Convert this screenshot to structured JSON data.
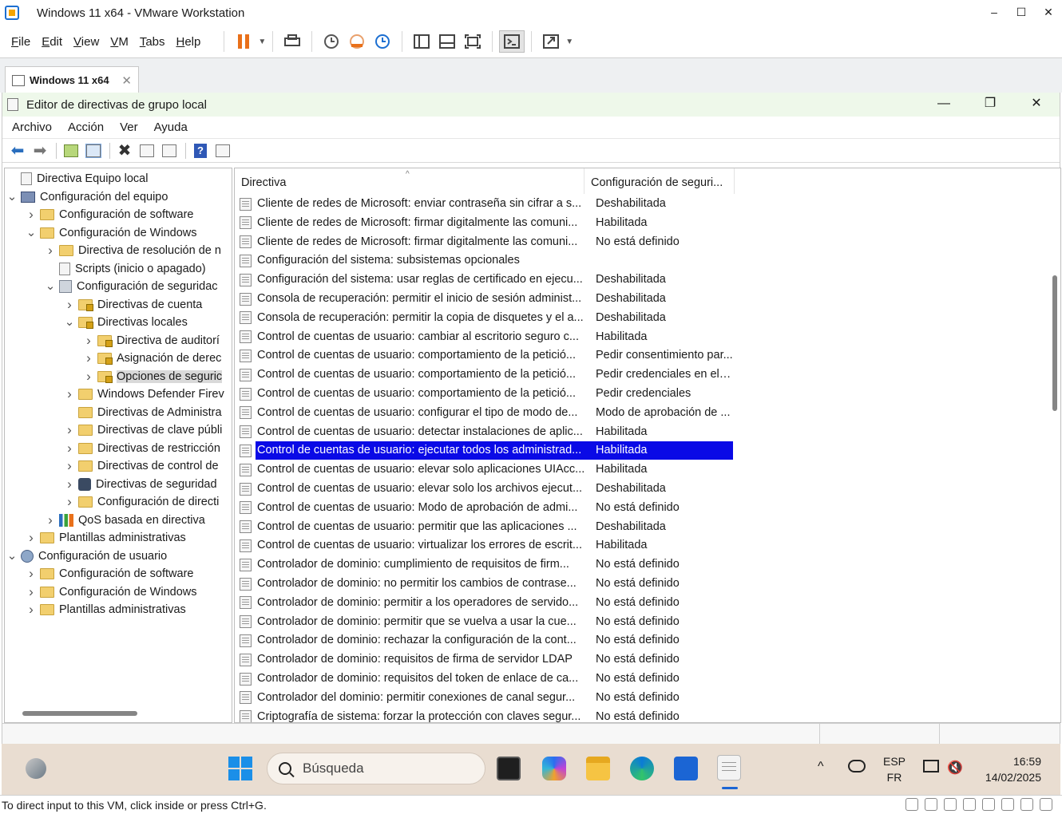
{
  "vm": {
    "title": "Windows 11 x64 - VMware Workstation",
    "menu": [
      {
        "label": "File",
        "u": "F",
        "rest": "ile"
      },
      {
        "label": "Edit",
        "u": "E",
        "rest": "dit"
      },
      {
        "label": "View",
        "u": "V",
        "rest": "iew"
      },
      {
        "label": "VM",
        "u": "V",
        "rest": "M"
      },
      {
        "label": "Tabs",
        "u": "T",
        "rest": "abs"
      },
      {
        "label": "Help",
        "u": "H",
        "rest": "elp"
      }
    ],
    "window_controls": {
      "minimize": "–",
      "maximize": "☐",
      "close": "✕"
    },
    "tab_label": "Windows 11 x64",
    "tab_close": "✕",
    "status_message": "To direct input to this VM, click inside or press Ctrl+G."
  },
  "gpe": {
    "title": "Editor de directivas de grupo local",
    "window_controls": {
      "minimize": "—",
      "restore": "❐",
      "close": "✕"
    },
    "menu": [
      "Archivo",
      "Acción",
      "Ver",
      "Ayuda"
    ],
    "tree": [
      {
        "label": "Directiva Equipo local",
        "level": 0,
        "chev": "",
        "icon": "doc"
      },
      {
        "label": "Configuración del equipo",
        "level": 0,
        "chev": "v",
        "icon": "computer"
      },
      {
        "label": "Configuración de software",
        "level": 1,
        "chev": ">",
        "icon": "folder"
      },
      {
        "label": "Configuración de Windows",
        "level": 1,
        "chev": "v",
        "icon": "folder"
      },
      {
        "label": "Directiva de resolución de n",
        "level": 2,
        "chev": ">",
        "icon": "folder"
      },
      {
        "label": "Scripts (inicio o apagado)",
        "level": 2,
        "chev": "",
        "icon": "doc"
      },
      {
        "label": "Configuración de seguridac",
        "level": 2,
        "chev": "v",
        "icon": "secure"
      },
      {
        "label": "Directivas de cuenta",
        "level": 3,
        "chev": ">",
        "icon": "folder-lock"
      },
      {
        "label": "Directivas locales",
        "level": 3,
        "chev": "v",
        "icon": "folder-lock"
      },
      {
        "label": "Directiva de auditorí",
        "level": 4,
        "chev": ">",
        "icon": "folder-lock"
      },
      {
        "label": "Asignación de derec",
        "level": 4,
        "chev": ">",
        "icon": "folder-lock"
      },
      {
        "label": "Opciones de seguric",
        "level": 4,
        "chev": ">",
        "icon": "folder-lock",
        "selected": true
      },
      {
        "label": "Windows Defender Firev",
        "level": 3,
        "chev": ">",
        "icon": "folder"
      },
      {
        "label": "Directivas de Administra",
        "level": 3,
        "chev": "",
        "icon": "folder"
      },
      {
        "label": "Directivas de clave públi",
        "level": 3,
        "chev": ">",
        "icon": "folder"
      },
      {
        "label": "Directivas de restricción",
        "level": 3,
        "chev": ">",
        "icon": "folder"
      },
      {
        "label": "Directivas de control de",
        "level": 3,
        "chev": ">",
        "icon": "folder"
      },
      {
        "label": "Directivas de seguridad",
        "level": 3,
        "chev": ">",
        "icon": "shield"
      },
      {
        "label": "Configuración de directi",
        "level": 3,
        "chev": ">",
        "icon": "folder"
      },
      {
        "label": "QoS basada en directiva",
        "level": 2,
        "chev": ">",
        "icon": "chart"
      },
      {
        "label": "Plantillas administrativas",
        "level": 1,
        "chev": ">",
        "icon": "folder"
      },
      {
        "label": "Configuración de usuario",
        "level": 0,
        "chev": "v",
        "icon": "user"
      },
      {
        "label": "Configuración de software",
        "level": 1,
        "chev": ">",
        "icon": "folder"
      },
      {
        "label": "Configuración de Windows",
        "level": 1,
        "chev": ">",
        "icon": "folder"
      },
      {
        "label": "Plantillas administrativas",
        "level": 1,
        "chev": ">",
        "icon": "folder"
      }
    ],
    "columns": [
      "Directiva",
      "Configuración de seguri..."
    ],
    "sort_indicator": "^",
    "policies": [
      {
        "name": "Cliente de redes de Microsoft: enviar contraseña sin cifrar a s...",
        "value": "Deshabilitada"
      },
      {
        "name": "Cliente de redes de Microsoft: firmar digitalmente las comuni...",
        "value": "Habilitada"
      },
      {
        "name": "Cliente de redes de Microsoft: firmar digitalmente las comuni...",
        "value": "No está definido"
      },
      {
        "name": "Configuración del sistema: subsistemas opcionales",
        "value": ""
      },
      {
        "name": "Configuración del sistema: usar reglas de certificado en ejecu...",
        "value": "Deshabilitada"
      },
      {
        "name": "Consola de recuperación: permitir el inicio de sesión administ...",
        "value": "Deshabilitada"
      },
      {
        "name": "Consola de recuperación: permitir la copia de disquetes y el a...",
        "value": "Deshabilitada"
      },
      {
        "name": "Control de cuentas de usuario: cambiar al escritorio seguro c...",
        "value": "Habilitada"
      },
      {
        "name": "Control de cuentas de usuario: comportamiento de la petició...",
        "value": "Pedir consentimiento par..."
      },
      {
        "name": "Control de cuentas de usuario: comportamiento de la petició...",
        "value": "Pedir credenciales en el e..."
      },
      {
        "name": "Control de cuentas de usuario: comportamiento de la petició...",
        "value": "Pedir credenciales"
      },
      {
        "name": "Control de cuentas de usuario: configurar el tipo de modo de...",
        "value": "Modo de aprobación de ..."
      },
      {
        "name": "Control de cuentas de usuario: detectar instalaciones de aplic...",
        "value": "Habilitada"
      },
      {
        "name": "Control de cuentas de usuario: ejecutar todos los administrad...",
        "value": "Habilitada",
        "selected": true
      },
      {
        "name": "Control de cuentas de usuario: elevar solo aplicaciones UIAcc...",
        "value": "Habilitada"
      },
      {
        "name": "Control de cuentas de usuario: elevar solo los archivos ejecut...",
        "value": "Deshabilitada"
      },
      {
        "name": "Control de cuentas de usuario: Modo de aprobación de admi...",
        "value": "No está definido"
      },
      {
        "name": "Control de cuentas de usuario: permitir que las aplicaciones ...",
        "value": "Deshabilitada"
      },
      {
        "name": "Control de cuentas de usuario: virtualizar los errores de escrit...",
        "value": "Habilitada"
      },
      {
        "name": "Controlador de dominio: cumplimiento de requisitos de firm...",
        "value": "No está definido"
      },
      {
        "name": "Controlador de dominio: no permitir los cambios de contrase...",
        "value": "No está definido"
      },
      {
        "name": "Controlador de dominio: permitir a los operadores de servido...",
        "value": "No está definido"
      },
      {
        "name": "Controlador de dominio: permitir que se vuelva a usar la cue...",
        "value": "No está definido"
      },
      {
        "name": "Controlador de dominio: rechazar la configuración de la cont...",
        "value": "No está definido"
      },
      {
        "name": "Controlador de dominio: requisitos de firma de servidor LDAP",
        "value": "No está definido"
      },
      {
        "name": "Controlador de dominio: requisitos del token de enlace de ca...",
        "value": "No está definido"
      },
      {
        "name": "Controlador del dominio: permitir conexiones de canal segur...",
        "value": "No está definido"
      },
      {
        "name": "Criptografía de sistema: forzar la protección con claves segur...",
        "value": "No está definido"
      }
    ]
  },
  "taskbar": {
    "search_placeholder": "Búsqueda",
    "tray_chevron": "^",
    "lang_primary": "ESP",
    "lang_secondary": "FR",
    "volume_glyph": "🔇",
    "time": "16:59",
    "date": "14/02/2025"
  }
}
